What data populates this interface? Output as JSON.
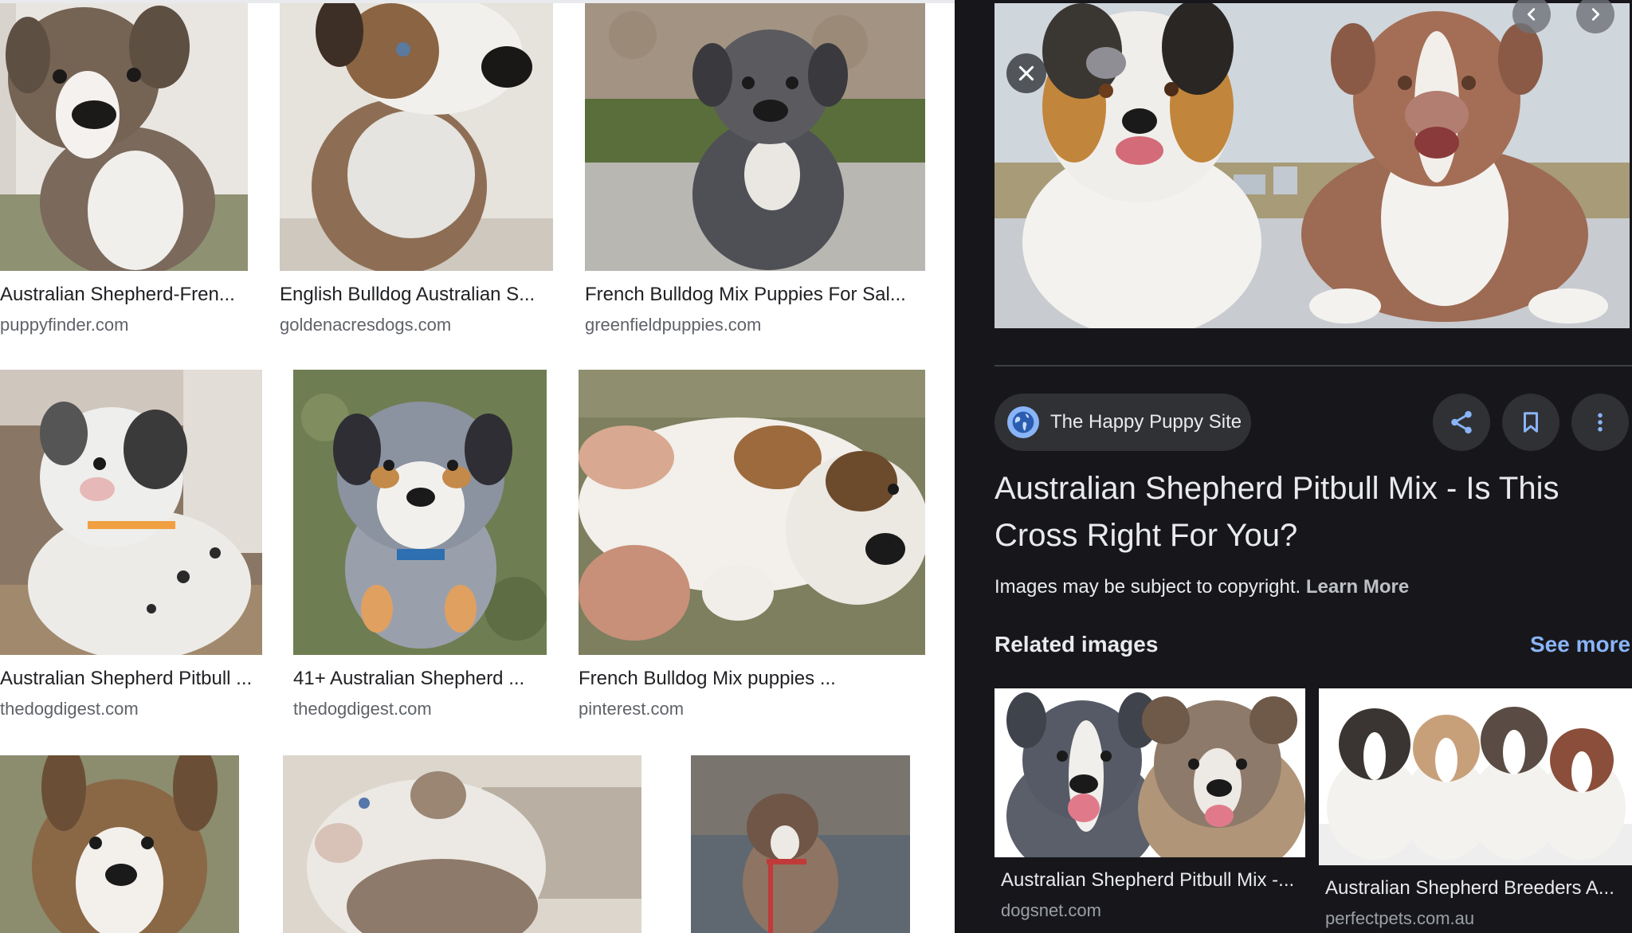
{
  "results": [
    {
      "caption": "Australian Shepherd-Fren...",
      "domain": "puppyfinder.com"
    },
    {
      "caption": "English Bulldog Australian S...",
      "domain": "goldenacresdogs.com"
    },
    {
      "caption": "French Bulldog Mix Puppies For Sal...",
      "domain": "greenfieldpuppies.com"
    },
    {
      "caption": "Australian Shepherd Pitbull ...",
      "domain": "thedogdigest.com"
    },
    {
      "caption": "41+ Australian Shepherd ...",
      "domain": "thedogdigest.com"
    },
    {
      "caption": "French Bulldog Mix puppies ...",
      "domain": "pinterest.com"
    }
  ],
  "panel": {
    "icons": {
      "close": "close-icon",
      "prev": "chevron-left-icon",
      "next": "chevron-right-icon",
      "source": "globe-icon",
      "share": "share-icon",
      "save": "bookmark-icon",
      "more": "more-vert-icon"
    },
    "source": "The Happy Puppy Site",
    "title": "Australian Shepherd Pitbull Mix - Is This Cross Right For You?",
    "copyright_text": "Images may be subject to copyright.",
    "learn_more": "Learn More",
    "related_heading": "Related images",
    "see_more": "See more",
    "related": [
      {
        "caption": "Australian Shepherd Pitbull Mix -...",
        "domain": "dogsnet.com"
      },
      {
        "caption": "Australian Shepherd Breeders A...",
        "domain": "perfectpets.com.au"
      }
    ]
  },
  "colors": {
    "panel_bg": "#17171b",
    "link_blue": "#8ab4f8",
    "caption_text": "#202124",
    "domain_text": "#5f6368"
  }
}
